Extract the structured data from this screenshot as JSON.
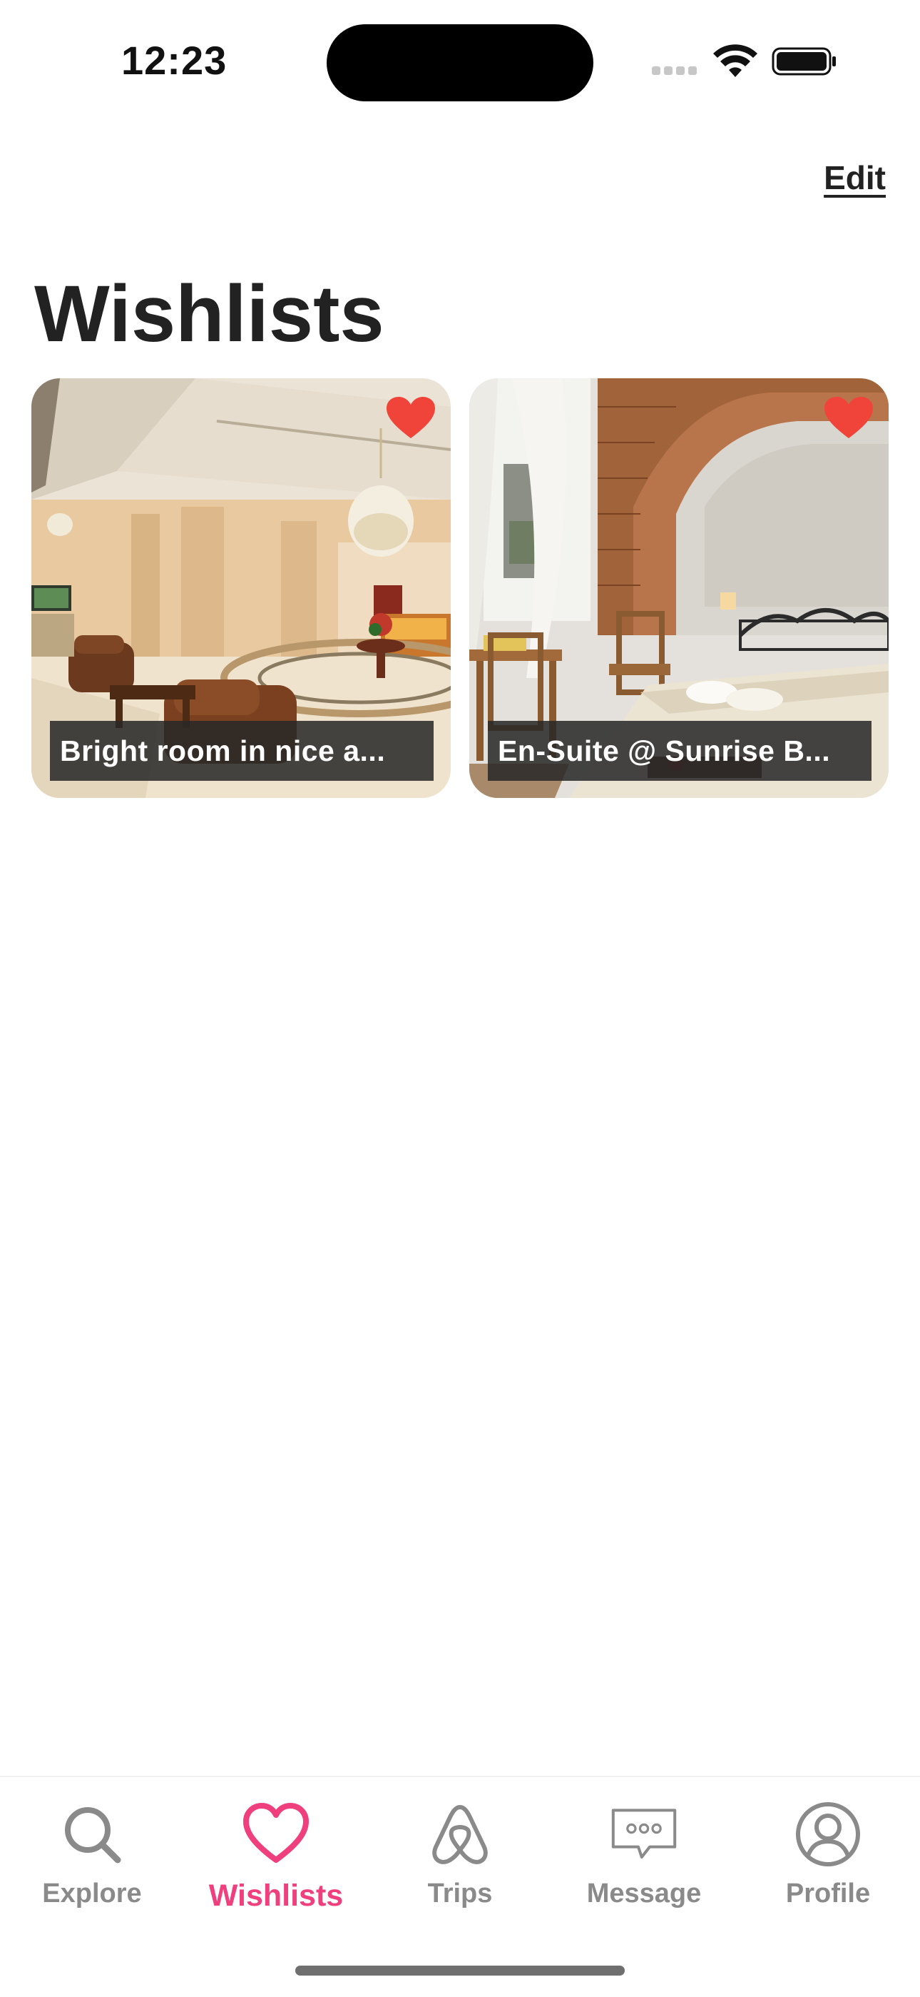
{
  "status_bar": {
    "time": "12:23",
    "signal_icon": "cellular-signal-icon",
    "wifi_icon": "wifi-icon",
    "battery_icon": "battery-icon"
  },
  "header": {
    "edit_label": "Edit",
    "title": "Wishlists"
  },
  "wishlists": [
    {
      "title": "Bright room in nice a...",
      "favorited": true,
      "image": "hotel-lobby-photo"
    },
    {
      "title": "En-Suite @ Sunrise B...",
      "favorited": true,
      "image": "bedroom-brick-arch-photo"
    }
  ],
  "tab_bar": {
    "tabs": [
      {
        "label": "Explore",
        "icon": "search-icon",
        "active": false
      },
      {
        "label": "Wishlists",
        "icon": "heart-icon",
        "active": true
      },
      {
        "label": "Trips",
        "icon": "airbnb-logo-icon",
        "active": false
      },
      {
        "label": "Message",
        "icon": "message-bubble-icon",
        "active": false
      },
      {
        "label": "Profile",
        "icon": "profile-icon",
        "active": false
      }
    ]
  },
  "colors": {
    "accent": "#ef3f7d",
    "heart": "#f0443a",
    "title_text": "#222222",
    "inactive_tab": "#8a8a8a",
    "label_bg": "#282828"
  }
}
